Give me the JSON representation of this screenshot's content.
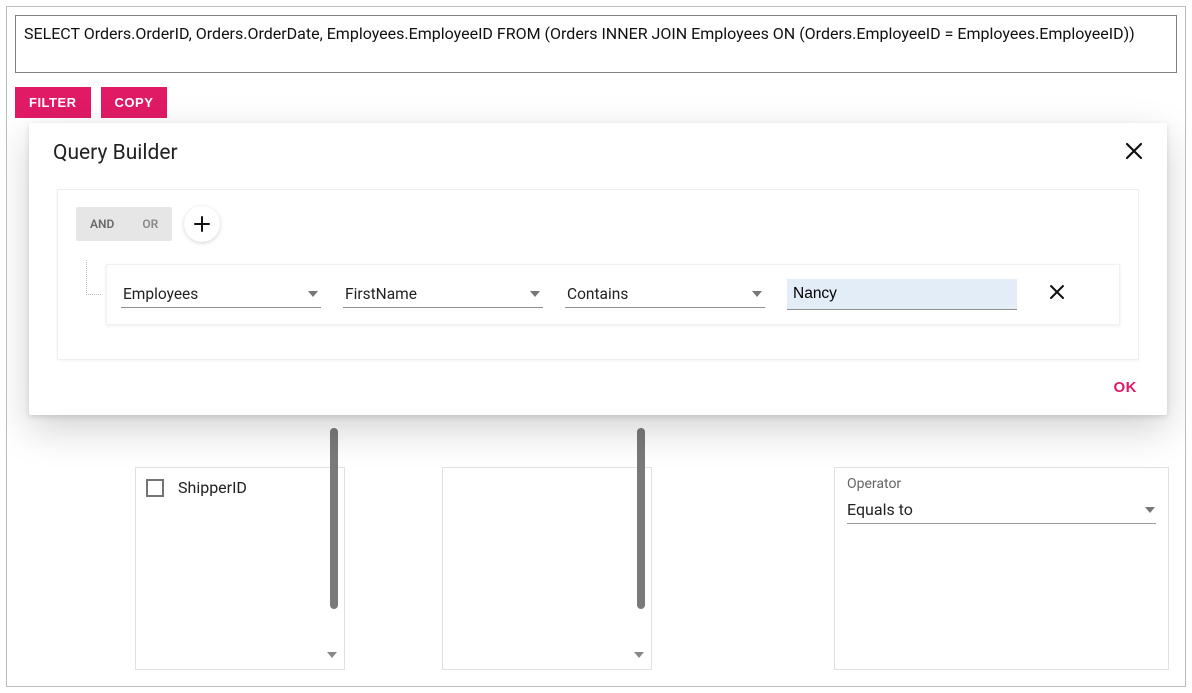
{
  "sql": "SELECT Orders.OrderID, Orders.OrderDate, Employees.EmployeeID FROM (Orders INNER JOIN Employees ON (Orders.EmployeeID = Employees.EmployeeID))",
  "buttons": {
    "filter": "FILTER",
    "copy": "COPY"
  },
  "modal": {
    "title": "Query Builder",
    "logic": {
      "and": "AND",
      "or": "OR",
      "selected": "AND"
    },
    "rule": {
      "table": "Employees",
      "field": "FirstName",
      "operator": "Contains",
      "value": "Nancy"
    },
    "ok": "OK"
  },
  "background": {
    "fields": [
      {
        "label": "ShipperID",
        "checked": false
      }
    ],
    "right_panel": {
      "operator_label": "Operator",
      "operator_value": "Equals to"
    }
  }
}
